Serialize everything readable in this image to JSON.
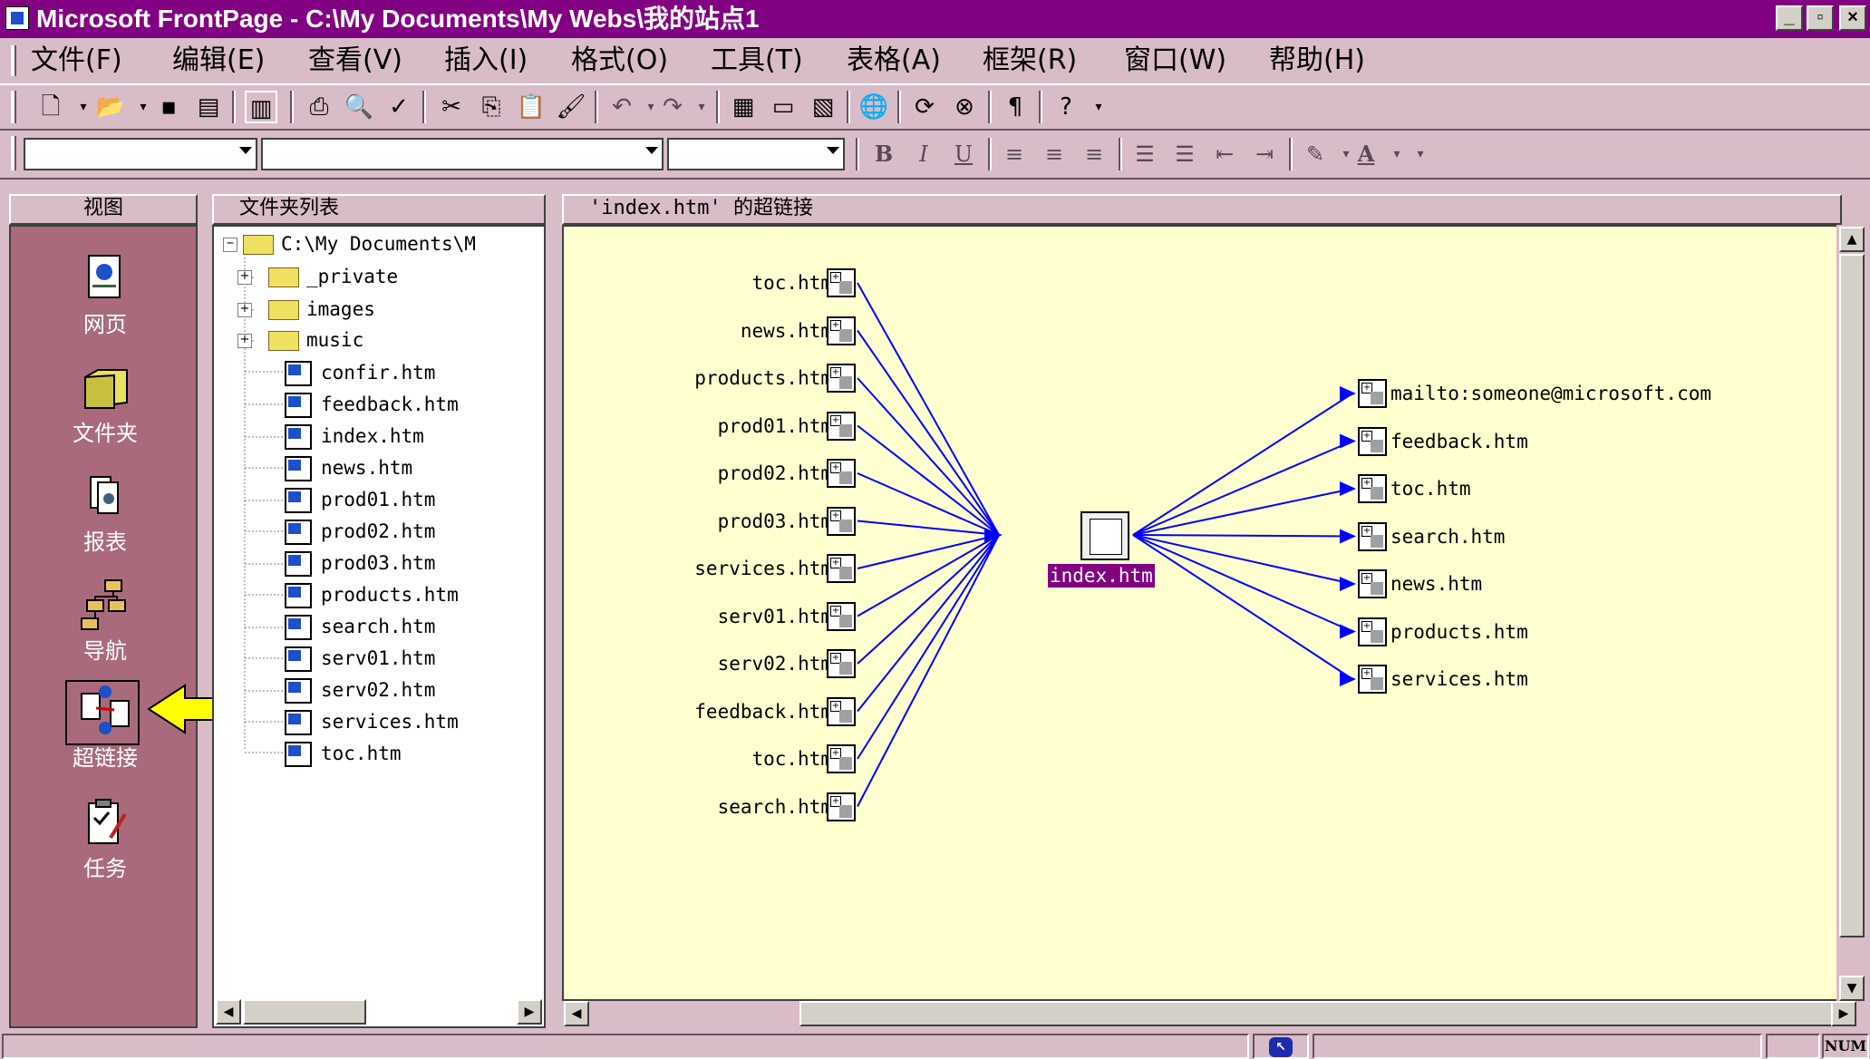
{
  "window": {
    "title": "Microsoft FrontPage - C:\\My Documents\\My Webs\\我的站点1",
    "controls": [
      "_",
      "▫",
      "×"
    ]
  },
  "menu": {
    "items": [
      "文件(F)",
      "编辑(E)",
      "查看(V)",
      "插入(I)",
      "格式(O)",
      "工具(T)",
      "表格(A)",
      "框架(R)",
      "窗口(W)",
      "帮助(H)"
    ]
  },
  "format_toolbar": {
    "bold": "B",
    "italic": "I",
    "underline": "U",
    "font_color": "A"
  },
  "views_pane": {
    "header": "视图",
    "items": [
      {
        "label": "网页",
        "icon": "page-view-icon"
      },
      {
        "label": "文件夹",
        "icon": "folder-view-icon"
      },
      {
        "label": "报表",
        "icon": "reports-view-icon"
      },
      {
        "label": "导航",
        "icon": "navigation-view-icon"
      },
      {
        "label": "超链接",
        "icon": "hyperlinks-view-icon"
      },
      {
        "label": "任务",
        "icon": "tasks-view-icon"
      }
    ]
  },
  "folder_pane": {
    "header": "文件夹列表",
    "root": "C:\\My Documents\\M",
    "folders": [
      "_private",
      "images",
      "music"
    ],
    "files": [
      "confir.htm",
      "feedback.htm",
      "index.htm",
      "news.htm",
      "prod01.htm",
      "prod02.htm",
      "prod03.htm",
      "products.htm",
      "search.htm",
      "serv01.htm",
      "serv02.htm",
      "services.htm",
      "toc.htm"
    ]
  },
  "main_pane": {
    "header": "'index.htm' 的超链接",
    "center_node": "index.htm",
    "incoming": [
      "toc.htm",
      "news.htm",
      "products.htm",
      "prod01.htm",
      "prod02.htm",
      "prod03.htm",
      "services.htm",
      "serv01.htm",
      "serv02.htm",
      "feedback.htm",
      "toc.htm",
      "search.htm"
    ],
    "outgoing": [
      "mailto:someone@microsoft.com",
      "feedback.htm",
      "toc.htm",
      "search.htm",
      "news.htm",
      "products.htm",
      "services.htm"
    ]
  },
  "status": {
    "num": "NUM"
  },
  "colors": {
    "title_bg": "#820082",
    "window_bg": "#D8BCC8",
    "views_bg": "#A96B7B",
    "canvas_bg": "#FFFFD0",
    "link_line": "#0000FF",
    "pointer_arrow": "#FFFF00"
  }
}
